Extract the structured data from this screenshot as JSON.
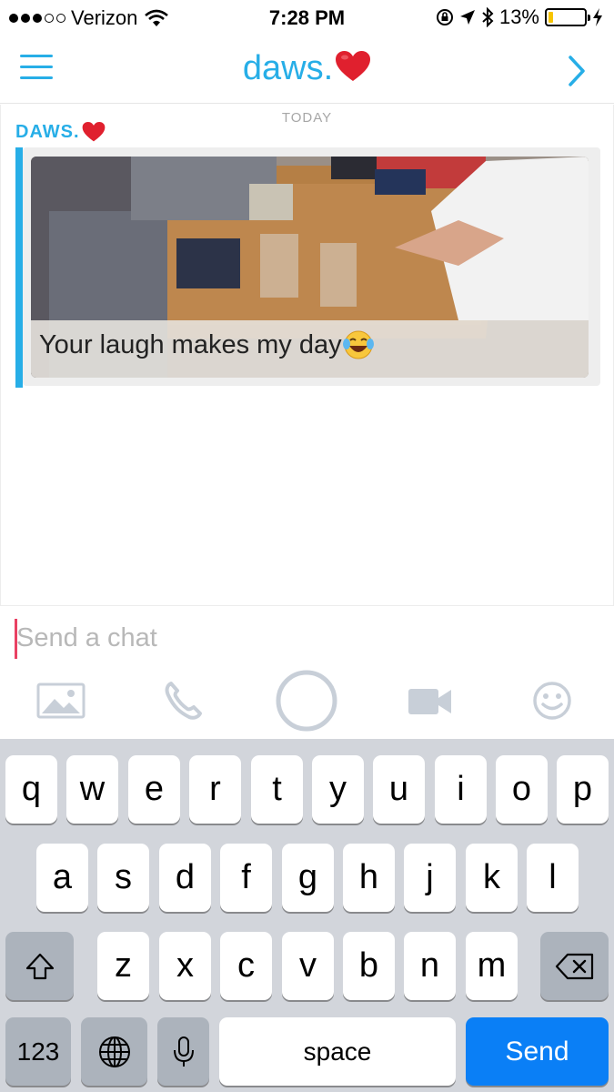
{
  "status_bar": {
    "carrier": "Verizon",
    "time": "7:28 PM",
    "battery": "13%",
    "battery_level": 0.13,
    "icons": [
      "signal-dots-icon",
      "wifi-icon",
      "rotation-lock-icon",
      "location-arrow-icon",
      "bluetooth-icon",
      "battery-icon",
      "charging-bolt-icon"
    ]
  },
  "header": {
    "title": "daws.",
    "title_emoji": "red-heart-icon",
    "menu_icon": "menu-icon",
    "forward_icon": "chevron-right-icon"
  },
  "chat": {
    "day_label": "TODAY",
    "sender": "DAWS.",
    "sender_emoji": "red-heart-icon",
    "message": {
      "type": "photo-with-caption",
      "caption": "Your laugh makes my day",
      "caption_emoji": "tears-of-joy-icon"
    }
  },
  "composer": {
    "placeholder": "Send a chat",
    "value": ""
  },
  "actions": [
    {
      "name": "gallery-button",
      "icon": "image-icon"
    },
    {
      "name": "call-button",
      "icon": "phone-icon"
    },
    {
      "name": "capture-button",
      "icon": "circle-shutter-icon"
    },
    {
      "name": "video-call-button",
      "icon": "video-camera-icon"
    },
    {
      "name": "emoji-button",
      "icon": "smiley-icon"
    }
  ],
  "keyboard": {
    "row1": [
      "q",
      "w",
      "e",
      "r",
      "t",
      "y",
      "u",
      "i",
      "o",
      "p"
    ],
    "row2": [
      "a",
      "s",
      "d",
      "f",
      "g",
      "h",
      "j",
      "k",
      "l"
    ],
    "row3": [
      "z",
      "x",
      "c",
      "v",
      "b",
      "n",
      "m"
    ],
    "numbers_label": "123",
    "space_label": "space",
    "send_label": "Send",
    "icons": [
      "shift-icon",
      "backspace-icon",
      "globe-icon",
      "microphone-icon"
    ]
  },
  "colors": {
    "accent": "#27aee7",
    "caret": "#e94163",
    "send_key": "#0a7ff6",
    "keyboard_bg": "#d2d5db"
  }
}
